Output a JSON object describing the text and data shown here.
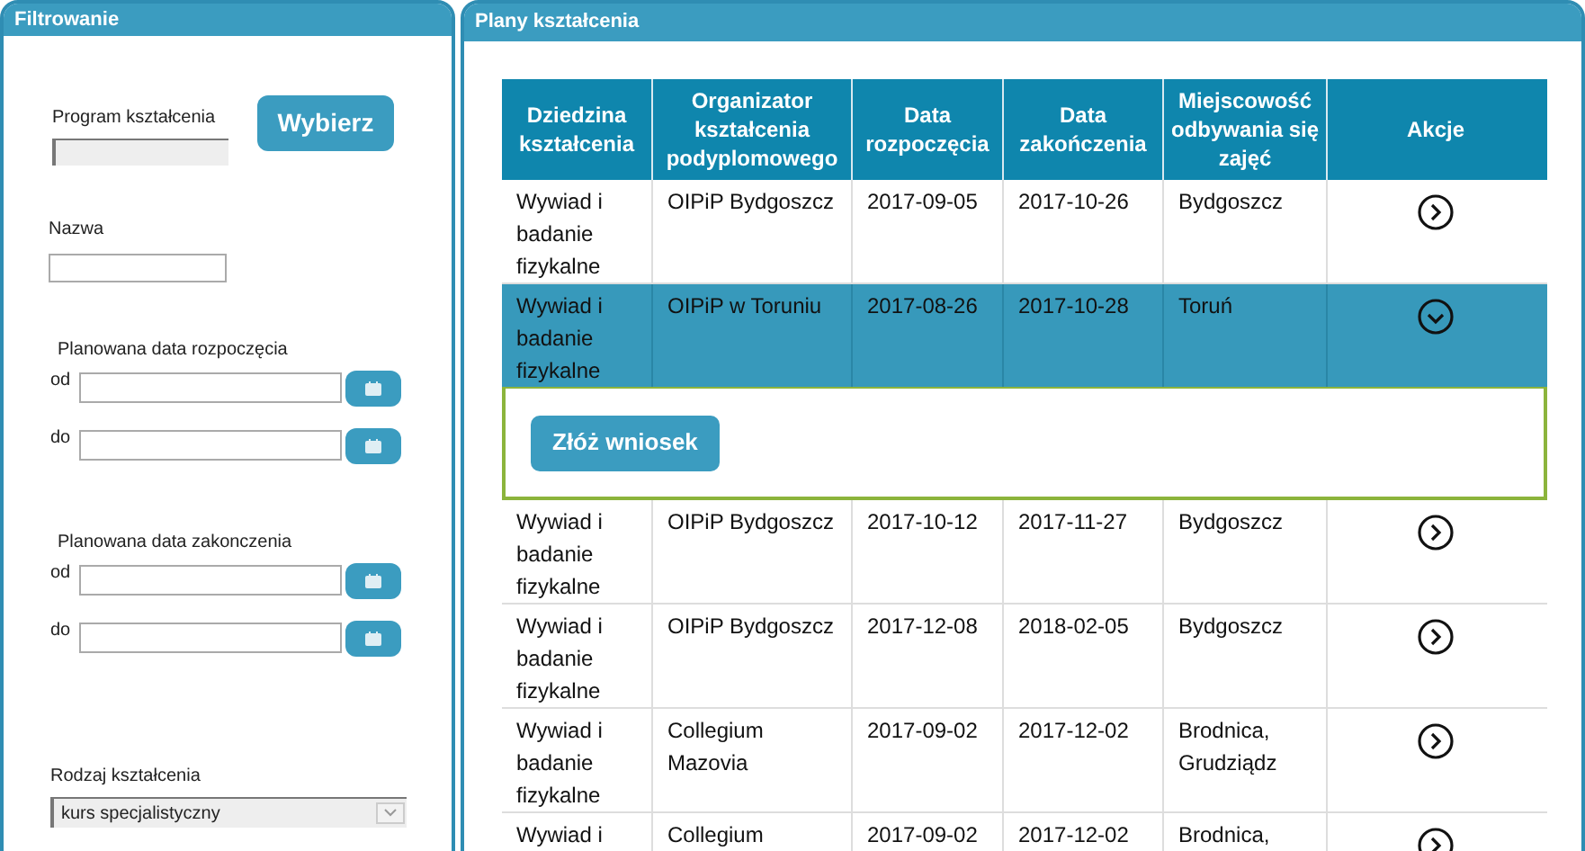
{
  "filter_panel": {
    "title": "Filtrowanie",
    "program": {
      "label": "Program kształcenia",
      "button": "Wybierz"
    },
    "name": {
      "label": "Nazwa"
    },
    "start_date": {
      "label": "Planowana data rozpoczęcia",
      "from": "od",
      "to": "do"
    },
    "end_date": {
      "label": "Planowana data zakonczenia",
      "from": "od",
      "to": "do"
    },
    "type": {
      "label": "Rodzaj kształcenia",
      "value": "kurs specjalistyczny"
    }
  },
  "plans_panel": {
    "title": "Plany kształcenia",
    "table": {
      "columns": [
        "Dziedzina kształcenia",
        "Organizator kształcenia podyplomowego",
        "Data rozpoczęcia",
        "Data zakończenia",
        "Miejscowość odbywania się zajęć",
        "Akcje"
      ],
      "rows": [
        {
          "cells": [
            "Wywiad i badanie fizykalne",
            "OIPiP Bydgoszcz",
            "2017-09-05",
            "2017-10-26",
            "Bydgoszcz"
          ],
          "expanded": false
        },
        {
          "cells": [
            "Wywiad i badanie fizykalne",
            "OIPiP w Toruniu",
            "2017-08-26",
            "2017-10-28",
            "Toruń"
          ],
          "expanded": true,
          "action_button": "Złóż wniosek"
        },
        {
          "cells": [
            "Wywiad i badanie fizykalne",
            "OIPiP Bydgoszcz",
            "2017-10-12",
            "2017-11-27",
            "Bydgoszcz"
          ],
          "expanded": false
        },
        {
          "cells": [
            "Wywiad i badanie fizykalne",
            "OIPiP Bydgoszcz",
            "2017-12-08",
            "2018-02-05",
            "Bydgoszcz"
          ],
          "expanded": false
        },
        {
          "cells": [
            "Wywiad i badanie fizykalne",
            "Collegium Mazovia",
            "2017-09-02",
            "2017-12-02",
            "Brodnica, Grudziądz"
          ],
          "expanded": false
        },
        {
          "cells": [
            "Wywiad i",
            "Collegium",
            "2017-09-02",
            "2017-12-02",
            "Brodnica,"
          ],
          "expanded": false
        }
      ]
    }
  }
}
